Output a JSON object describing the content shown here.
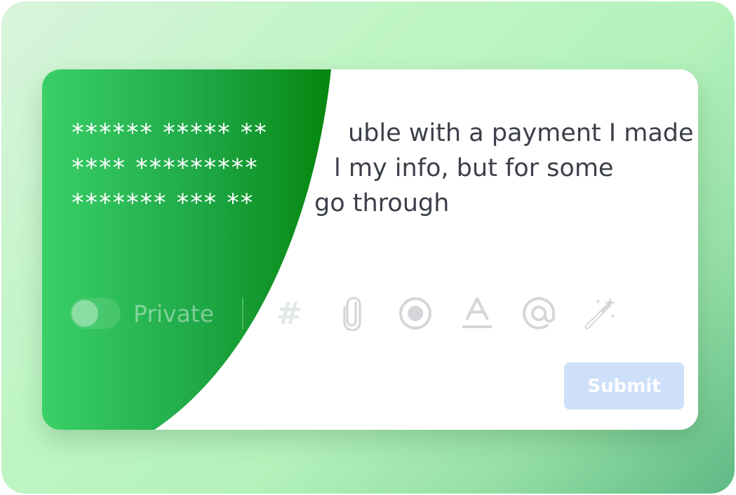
{
  "message": {
    "line1_masked": "****** ***** **",
    "line1_visible": "uble with a payment I made",
    "line2_masked": "**** *********",
    "line2_visible": "l my info, but for some",
    "line3_masked": "******* *** **",
    "line3_visible": "go through"
  },
  "toolbar": {
    "private_label": "Private",
    "private_toggle_on": false,
    "hash_glyph": "#",
    "icons": [
      "hashtag-icon",
      "paperclip-icon",
      "record-icon",
      "text-format-icon",
      "at-mention-icon",
      "magic-wand-icon"
    ]
  },
  "actions": {
    "submit_label": "Submit"
  },
  "colors": {
    "accent_green": "#0a8a1f",
    "light_green": "#3fd06a",
    "submit_bg": "#cddff9"
  }
}
